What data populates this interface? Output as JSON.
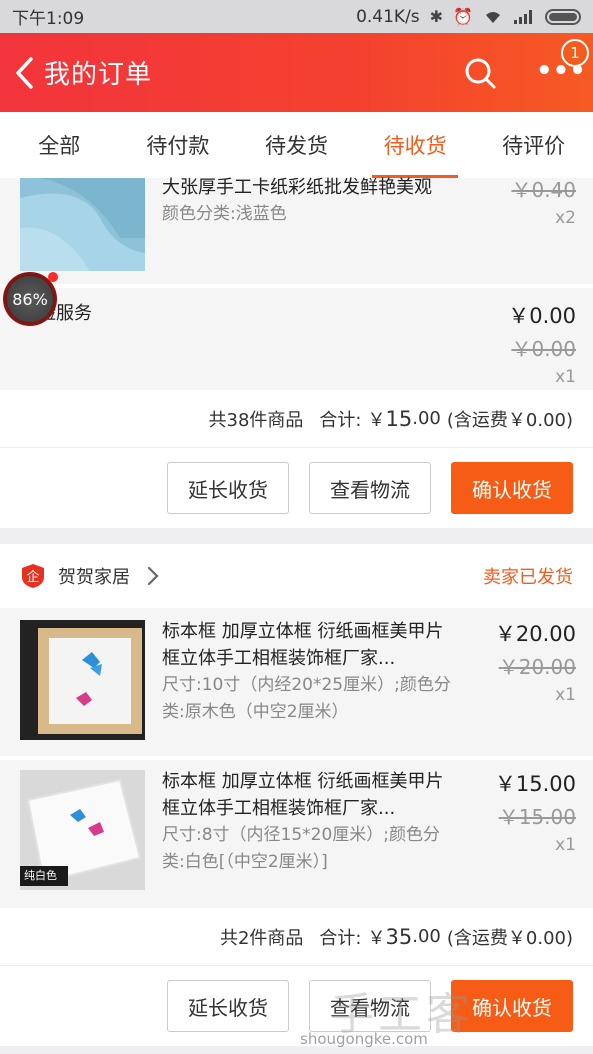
{
  "status_bar": {
    "time": "下午1:09",
    "network_speed": "0.41K/s",
    "icons": [
      "bluetooth-icon",
      "alarm-icon",
      "wifi-icon",
      "signal-icon",
      "battery-icon"
    ]
  },
  "header": {
    "title": "我的订单",
    "notification_count": "1",
    "colors": {
      "gradient_start": "#f2343c",
      "gradient_end": "#f65a23"
    }
  },
  "tabs": [
    {
      "label": "全部"
    },
    {
      "label": "待付款"
    },
    {
      "label": "待发货"
    },
    {
      "label": "待收货",
      "active": true
    },
    {
      "label": "待评价"
    }
  ],
  "order1": {
    "items": [
      {
        "name": "大张厚手工卡纸彩纸批发鲜艳美观",
        "spec": "颜色分类:浅蓝色",
        "orig_price": "￥0.40",
        "qty": "x2"
      },
      {
        "name": "保险服务",
        "price": "￥0.00",
        "orig_price": "￥0.00",
        "qty": "x1"
      }
    ],
    "total": {
      "count_text": "共38件商品",
      "sum_label": "合计:",
      "amount_prefix": "￥",
      "amount_int": "15",
      "amount_dec": ".00",
      "shipping": "(含运费￥0.00)"
    },
    "buttons": {
      "extend": "延长收货",
      "logistics": "查看物流",
      "confirm": "确认收货"
    }
  },
  "floating_progress": "86%",
  "order2": {
    "shop_name": "贺贺家居",
    "shop_status": "卖家已发货",
    "items": [
      {
        "name": "标本框 加厚立体框 衍纸画框美甲片框立体手工相框装饰框厂家...",
        "spec": "尺寸:10寸（内经20*25厘米）;颜色分类:原木色（中空2厘米）",
        "price": "￥20.00",
        "orig_price": "￥20.00",
        "qty": "x1"
      },
      {
        "name": "标本框 加厚立体框 衍纸画框美甲片框立体手工相框装饰框厂家...",
        "spec": "尺寸:8寸（内径15*20厘米）;颜色分类:白色[（中空2厘米）]",
        "price": "￥15.00",
        "orig_price": "￥15.00",
        "qty": "x1",
        "thumb_label": "纯白色"
      }
    ],
    "total": {
      "count_text": "共2件商品",
      "sum_label": "合计:",
      "amount_prefix": "￥",
      "amount_int": "35",
      "amount_dec": ".00",
      "shipping": "(含运费￥0.00)"
    },
    "buttons": {
      "extend": "延长收货",
      "logistics": "查看物流",
      "confirm": "确认收货"
    }
  },
  "watermark": {
    "cn": "手工客",
    "url": "shougongke.com"
  },
  "accent_color": "#f45c1d"
}
